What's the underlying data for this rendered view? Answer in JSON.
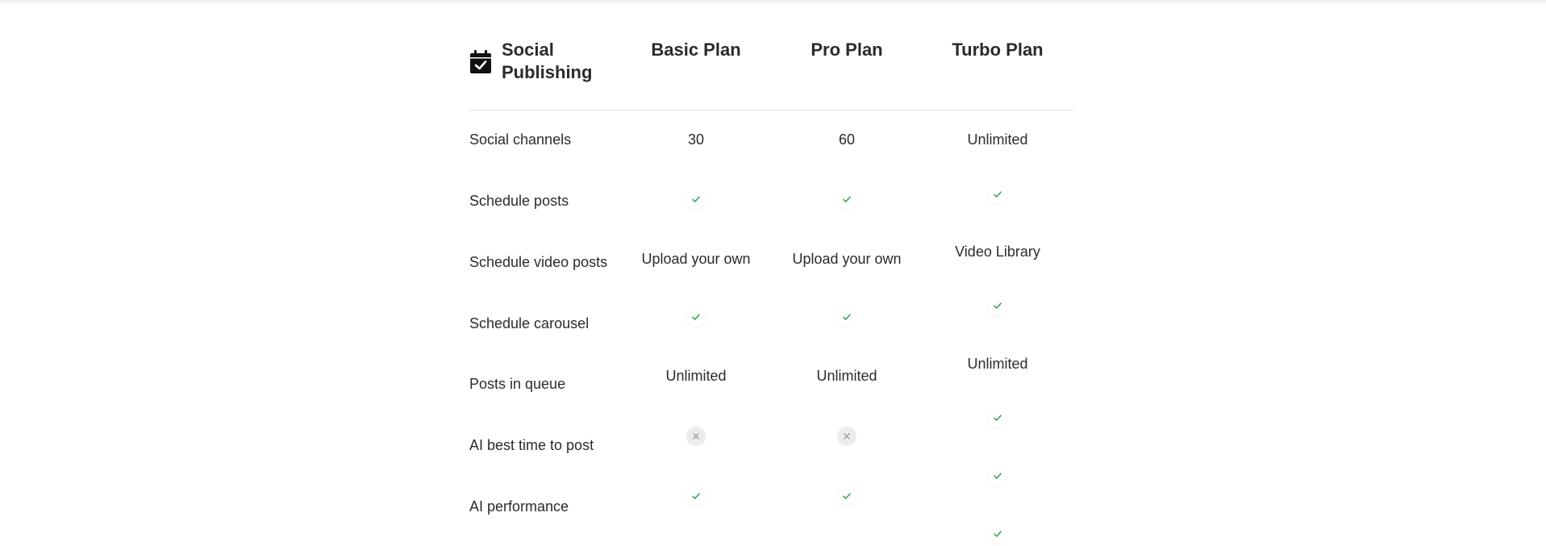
{
  "table": {
    "title": "Social Publishing",
    "title_icon": "calendar-check-icon",
    "plans": [
      "Basic Plan",
      "Pro Plan",
      "Turbo Plan"
    ],
    "rows": [
      {
        "label": "Social channels",
        "basic": "30",
        "pro": "60",
        "turbo": "Unlimited"
      },
      {
        "label": "Schedule posts",
        "basic": "check",
        "pro": "check",
        "turbo": "check"
      },
      {
        "label": "Schedule video posts",
        "basic": "Upload your own",
        "pro": "Upload your own",
        "turbo": "Video Library"
      },
      {
        "label": "Schedule carousel",
        "basic": "check",
        "pro": "check",
        "turbo": "check"
      },
      {
        "label": "Posts in queue",
        "basic": "Unlimited",
        "pro": "Unlimited",
        "turbo": "Unlimited"
      },
      {
        "label": "AI best time to post",
        "basic": "cross",
        "pro": "cross",
        "turbo": "check"
      },
      {
        "label": "AI performance",
        "basic": "check",
        "pro": "check",
        "turbo": "check"
      }
    ],
    "turbo_extra": [
      "check"
    ]
  },
  "colors": {
    "text": "#2b2b2b",
    "check": "#3aa65b",
    "cross": "#9a9a9a",
    "divider": "#e3e3e3"
  }
}
